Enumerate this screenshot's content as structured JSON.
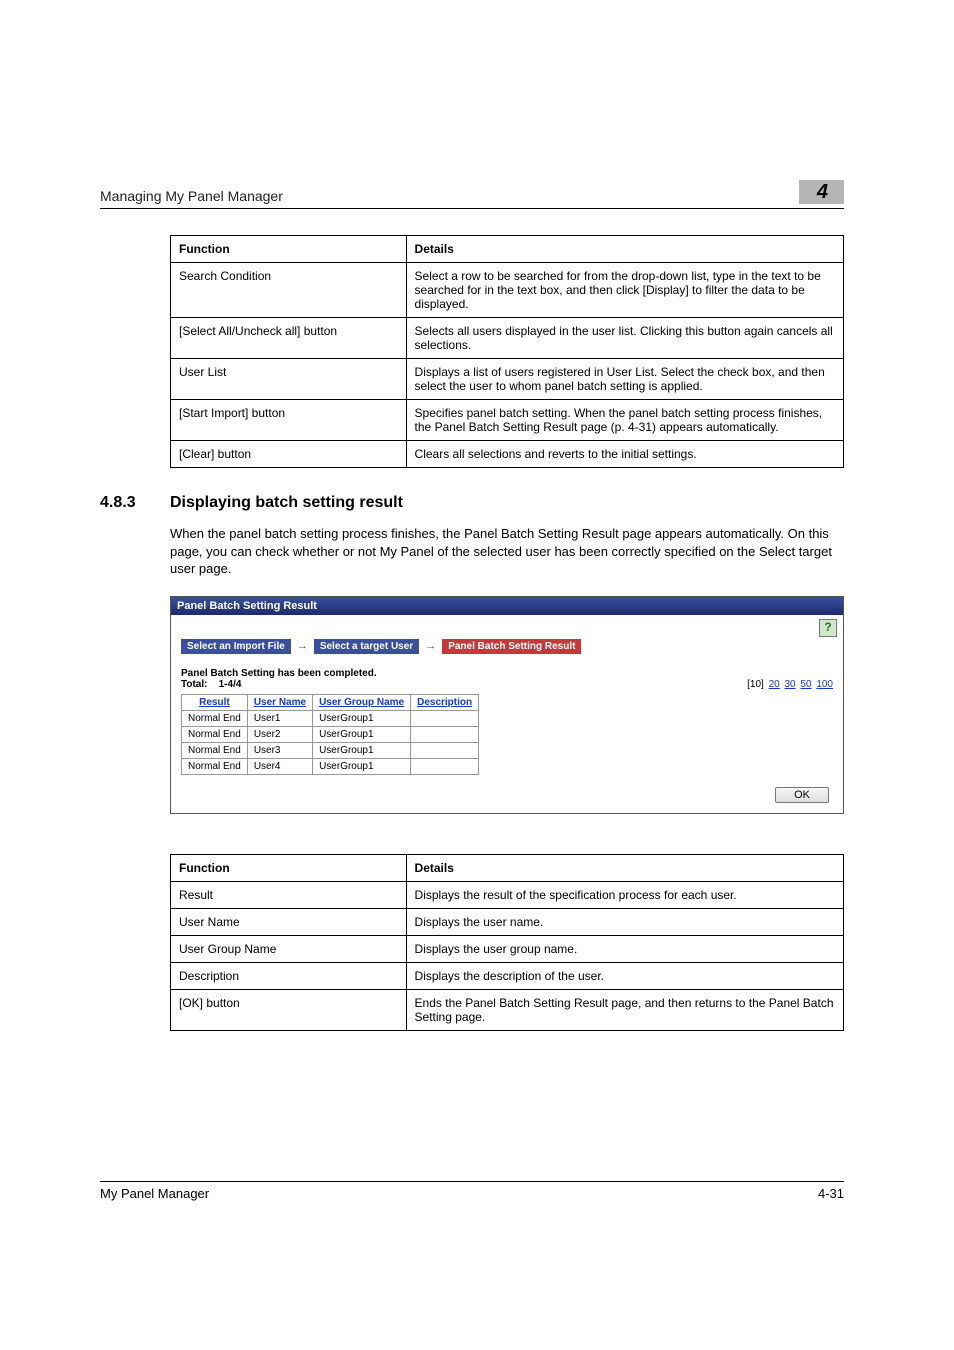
{
  "header": {
    "title": "Managing My Panel Manager",
    "page_badge": "4"
  },
  "table1": {
    "head_func": "Function",
    "head_det": "Details",
    "rows": [
      {
        "func": "Search Condition",
        "det": "Select a row to be searched for from the drop-down list, type in the text to be searched for in the text box, and then click [Display] to filter the data to be displayed."
      },
      {
        "func": "[Select All/Uncheck all] button",
        "det": "Selects all users displayed in the user list. Clicking this button again cancels all selections."
      },
      {
        "func": "User List",
        "det": "Displays a list of users registered in User List. Select the check box, and then select the user to whom panel batch setting is applied."
      },
      {
        "func": "[Start Import] button",
        "det": "Specifies panel batch setting. When the panel batch setting process finishes, the Panel Batch Setting Result page (p. 4-31) appears automatically."
      },
      {
        "func": "[Clear] button",
        "det": "Clears all selections and reverts to the initial settings."
      }
    ]
  },
  "section": {
    "num": "4.8.3",
    "title": "Displaying batch setting result",
    "body": "When the panel batch setting process finishes, the Panel Batch Setting Result page appears automatically. On this page, you can check whether or not My Panel of the selected user has been correctly specified on the Select target user page."
  },
  "screenshot": {
    "title": "Panel Batch Setting Result",
    "help": "?",
    "tabs": {
      "t1": "Select an Import File",
      "t2": "Select a target User",
      "t3": "Panel Batch Setting Result"
    },
    "status": {
      "msg": "Panel Batch Setting has been completed.",
      "total_label": "Total:",
      "total_val": "1-4/4"
    },
    "pager": {
      "cur": "[10]",
      "p20": "20",
      "p30": "30",
      "p50": "50",
      "p100": "100"
    },
    "head": {
      "result": "Result",
      "user": "User Name",
      "group": "User Group Name",
      "desc": "Description"
    },
    "rows": [
      {
        "result": "Normal End",
        "user": "User1",
        "group": "UserGroup1",
        "desc": ""
      },
      {
        "result": "Normal End",
        "user": "User2",
        "group": "UserGroup1",
        "desc": ""
      },
      {
        "result": "Normal End",
        "user": "User3",
        "group": "UserGroup1",
        "desc": ""
      },
      {
        "result": "Normal End",
        "user": "User4",
        "group": "UserGroup1",
        "desc": ""
      }
    ],
    "ok": "OK"
  },
  "table2": {
    "head_func": "Function",
    "head_det": "Details",
    "rows": [
      {
        "func": "Result",
        "det": "Displays the result of the specification process for each user."
      },
      {
        "func": "User Name",
        "det": "Displays the user name."
      },
      {
        "func": "User Group Name",
        "det": "Displays the user group name."
      },
      {
        "func": "Description",
        "det": "Displays the description of the user."
      },
      {
        "func": "[OK] button",
        "det": "Ends the Panel Batch Setting Result page, and then returns to the Panel Batch Setting page."
      }
    ]
  },
  "footer": {
    "left": "My Panel Manager",
    "right": "4-31"
  }
}
